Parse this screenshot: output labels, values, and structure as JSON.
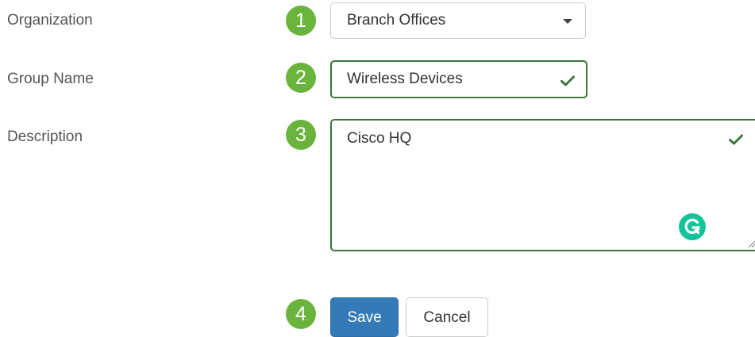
{
  "form": {
    "organization": {
      "label": "Organization",
      "step": "1",
      "value": "Branch Offices"
    },
    "group_name": {
      "label": "Group Name",
      "step": "2",
      "value": "Wireless Devices"
    },
    "description": {
      "label": "Description",
      "step": "3",
      "value": "Cisco HQ"
    },
    "actions": {
      "step": "4",
      "save_label": "Save",
      "cancel_label": "Cancel"
    }
  },
  "colors": {
    "step_badge": "#6ab43e",
    "valid_border": "#3c763d",
    "primary_button": "#337ab7",
    "grammarly": "#15c39a"
  },
  "icons": {
    "select_caret": "caret-down-icon",
    "valid": "checkmark-icon",
    "assistant": "grammarly-icon",
    "resize": "resize-handle-icon"
  }
}
